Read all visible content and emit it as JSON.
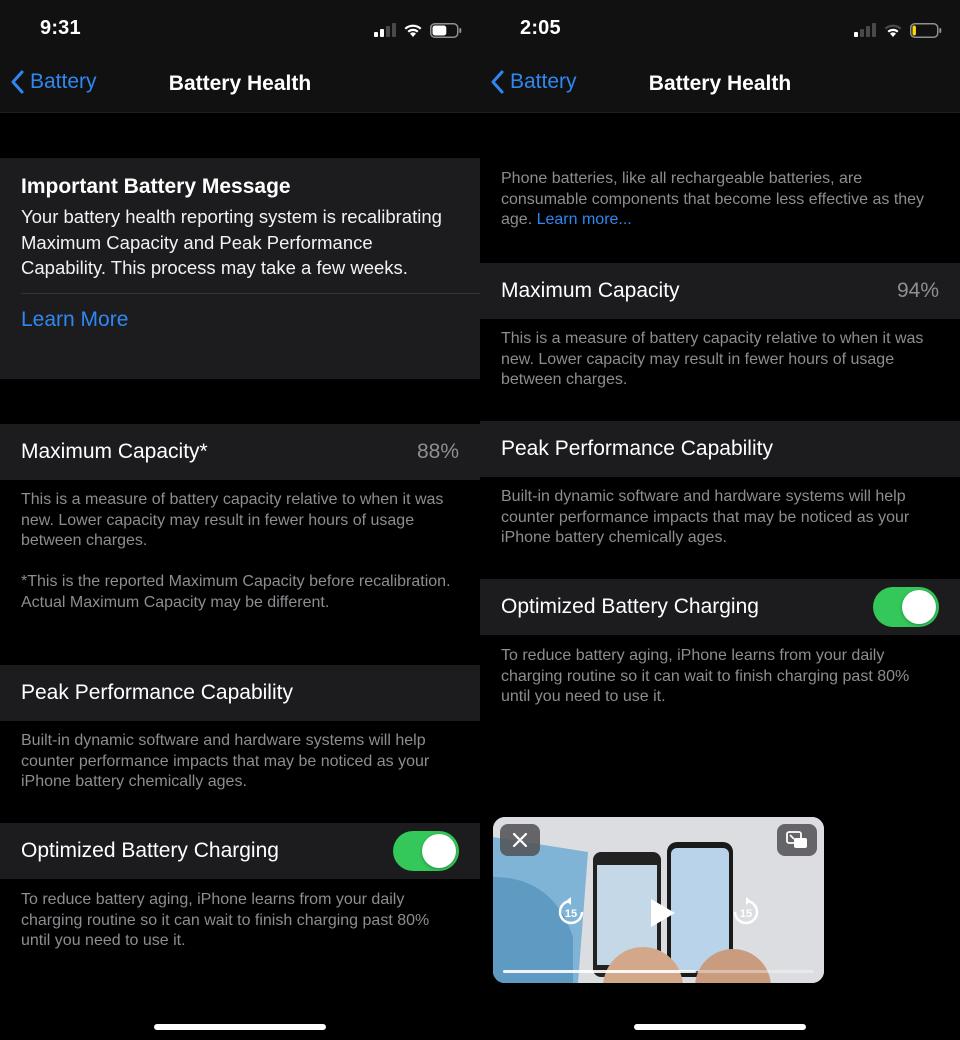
{
  "left": {
    "status": {
      "time": "9:31",
      "signal_bars": 2,
      "battery_level": 0.6,
      "battery_color": "#ffffff"
    },
    "nav": {
      "back_label": "Battery",
      "title": "Battery Health"
    },
    "message": {
      "title": "Important Battery Message",
      "body": "Your battery health reporting system is recalibrating Maximum Capacity and Peak Performance Capability. This process may take a few weeks.",
      "link": "Learn More"
    },
    "max_capacity": {
      "label": "Maximum Capacity*",
      "value": "88%",
      "footer": "This is a measure of battery capacity relative to when it was new. Lower capacity may result in fewer hours of usage between charges.",
      "note": "*This is the reported Maximum Capacity before recalibration. Actual Maximum Capacity may be different."
    },
    "peak": {
      "label": "Peak Performance Capability",
      "footer": "Built-in dynamic software and hardware systems will help counter performance impacts that may be noticed as your iPhone battery chemically ages."
    },
    "optimized": {
      "label": "Optimized Battery Charging",
      "enabled": true,
      "footer": "To reduce battery aging, iPhone learns from your daily charging routine so it can wait to finish charging past 80% until you need to use it."
    }
  },
  "right": {
    "status": {
      "time": "2:05",
      "signal_bars": 1,
      "battery_level": 0.15,
      "battery_color": "#ffd60a"
    },
    "nav": {
      "back_label": "Battery",
      "title": "Battery Health"
    },
    "intro": {
      "text": "Phone batteries, like all rechargeable batteries, are consumable components that become less effective as they age.",
      "link": "Learn more..."
    },
    "max_capacity": {
      "label": "Maximum Capacity",
      "value": "94%",
      "footer": "This is a measure of battery capacity relative to when it was new. Lower capacity may result in fewer hours of usage between charges."
    },
    "peak": {
      "label": "Peak Performance Capability",
      "footer": "Built-in dynamic software and hardware systems will help counter performance impacts that may be noticed as your iPhone battery chemically ages."
    },
    "optimized": {
      "label": "Optimized Battery Charging",
      "enabled": true,
      "footer": "To reduce battery aging, iPhone learns from your daily charging routine so it can wait to finish charging past 80% until you need to use it."
    },
    "pip_video": {
      "skip_back_seconds": "15",
      "skip_forward_seconds": "15",
      "progress": 0.62
    }
  },
  "colors": {
    "accent": "#2f87f2",
    "toggle_on": "#34c759",
    "cell_bg": "#1c1c1e",
    "secondary_text": "#8d8d92"
  }
}
